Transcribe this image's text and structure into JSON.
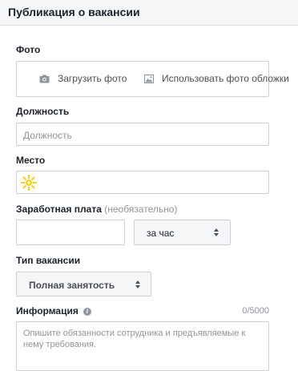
{
  "header": {
    "title": "Публикация о вакансии"
  },
  "photo": {
    "label": "Фото",
    "upload_label": "Загрузить фото",
    "use_cover_label": "Использовать фото обложки"
  },
  "position": {
    "label": "Должность",
    "placeholder": "Должность",
    "value": ""
  },
  "location": {
    "label": "Место",
    "value": ""
  },
  "salary": {
    "label": "Заработная плата",
    "optional": "(необязательно)",
    "value": "",
    "period_selected": "за час"
  },
  "job_type": {
    "label": "Тип вакансии",
    "selected": "Полная занятость"
  },
  "info": {
    "label": "Информация",
    "counter": "0/5000",
    "placeholder": "Опишите обязанности сотрудника и предъявляемые к нему требования."
  },
  "colors": {
    "header_bg": "#f5f6f7",
    "border": "#ccd0d5",
    "text": "#1d2129",
    "muted": "#90949c",
    "marker": "#f7d11a"
  }
}
